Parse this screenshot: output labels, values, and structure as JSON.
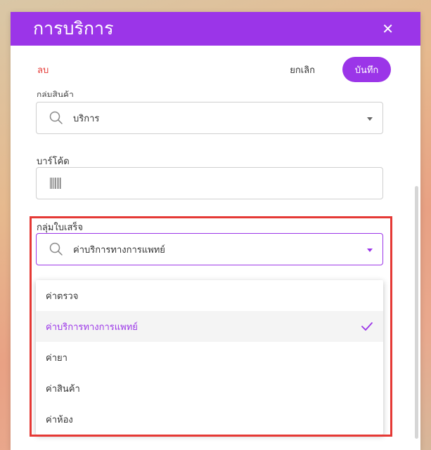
{
  "header": {
    "title": "การบริการ"
  },
  "actions": {
    "delete_label": "ลบ",
    "cancel_label": "ยกเลิก",
    "save_label": "บันทึก"
  },
  "form": {
    "product_group": {
      "label_partial": "กลุ่มสินค้า",
      "value": "บริการ"
    },
    "barcode": {
      "label": "บาร์โค้ด"
    },
    "receipt_group": {
      "label": "กลุ่มใบเสร็จ",
      "value": "ค่าบริการทางการแพทย์",
      "options": [
        "ค่าตรวจ",
        "ค่าบริการทางการแพทย์",
        "ค่ายา",
        "ค่าสินค้า",
        "ค่าห้อง"
      ],
      "selected_index": 1
    }
  },
  "colors": {
    "accent": "#9b35e8",
    "danger": "#e53935",
    "highlight": "#e53935"
  },
  "icons": [
    "close-icon",
    "search-icon",
    "chevron-down-icon",
    "barcode-icon",
    "check-icon"
  ]
}
